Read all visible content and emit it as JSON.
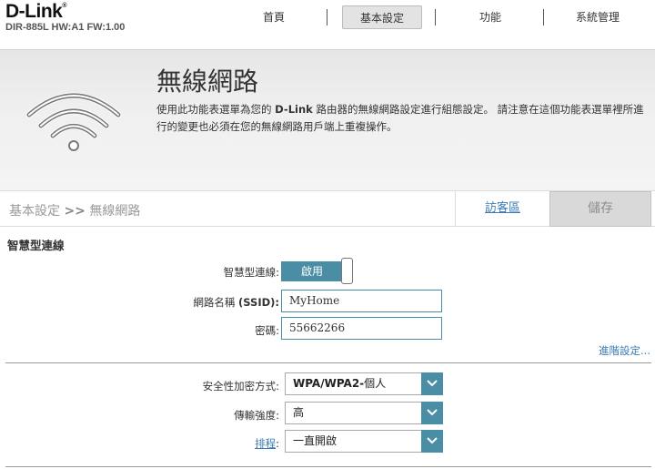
{
  "header": {
    "logo": "D-Link",
    "logo_mark": "®",
    "model": "DIR-885L HW:A1 FW:1.00",
    "nav": [
      "首頁",
      "基本設定",
      "功能",
      "系統管理"
    ]
  },
  "banner": {
    "title": "無線網路",
    "desc_pre": "使用此功能表選單為您的",
    "desc_brand": "D-Link",
    "desc_post": "路由器的無線網路設定進行組態設定。 請注意在這個功能表選單裡所進行的變更也必須在您的無線網路用戶端上重複操作。",
    "icon": "wifi-icon"
  },
  "breadcrumb": {
    "parent": "基本設定",
    "sep": ">>",
    "current": "無線網路",
    "guest_label": "訪客區",
    "save_label": "儲存"
  },
  "section": {
    "title": "智慧型連線",
    "smart_label": "智慧型連線:",
    "smart_value": "啟用",
    "ssid_label_pre": "網路名稱 ",
    "ssid_label_bold": "(SSID):",
    "ssid_value": "MyHome",
    "password_label": "密碼:",
    "password_value": "55662266",
    "advanced_link": "進階設定..."
  },
  "security": {
    "mode_label": "安全性加密方式:",
    "mode_value_bold": "WPA/WPA2-",
    "mode_value_rest": "個人",
    "power_label": "傳輸強度:",
    "power_value": "高",
    "schedule_label": "排程",
    "schedule_colon": ":",
    "schedule_value": "一直開啟"
  },
  "colors": {
    "accent": "#4a8ea5",
    "link": "#3a7ab4",
    "save_disabled": "#d9d9d9"
  }
}
